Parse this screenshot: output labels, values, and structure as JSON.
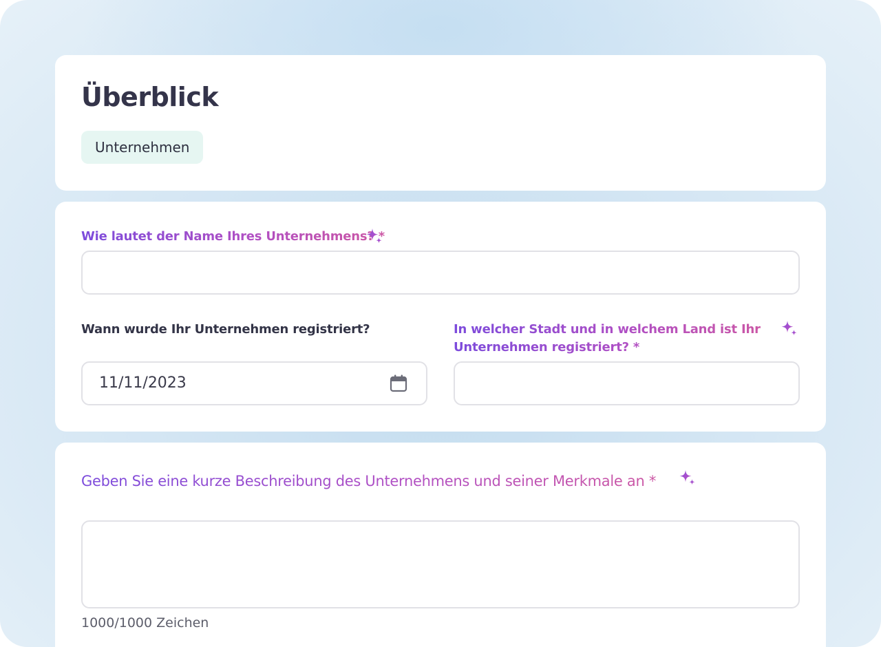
{
  "overview": {
    "title": "Überblick",
    "section_chip": "Unternehmen"
  },
  "company": {
    "name_question": "Wie lautet der Name Ihres Unternehmens? *",
    "name_value": "",
    "registration_date_question": "Wann wurde Ihr Unternehmen registriert?",
    "registration_date_value": "11/11/2023",
    "registration_location_question_line1": "In welcher Stadt und in welchem Land ist Ihr",
    "registration_location_question_line2": "Unternehmen registriert? *",
    "registration_location_value": ""
  },
  "description": {
    "question": "Geben Sie eine kurze Beschreibung des Unternehmens und seiner Merkmale an *",
    "value": "",
    "char_counter": "1000/1000 Zeichen"
  },
  "icons": {
    "sparkle": "sparkle-icon",
    "calendar": "calendar-icon"
  },
  "colors": {
    "accent_gradient_start": "#7c4bdc",
    "accent_gradient_end": "#cc57a4",
    "chip_background": "#e6f6f2",
    "title_text": "#34344a"
  }
}
